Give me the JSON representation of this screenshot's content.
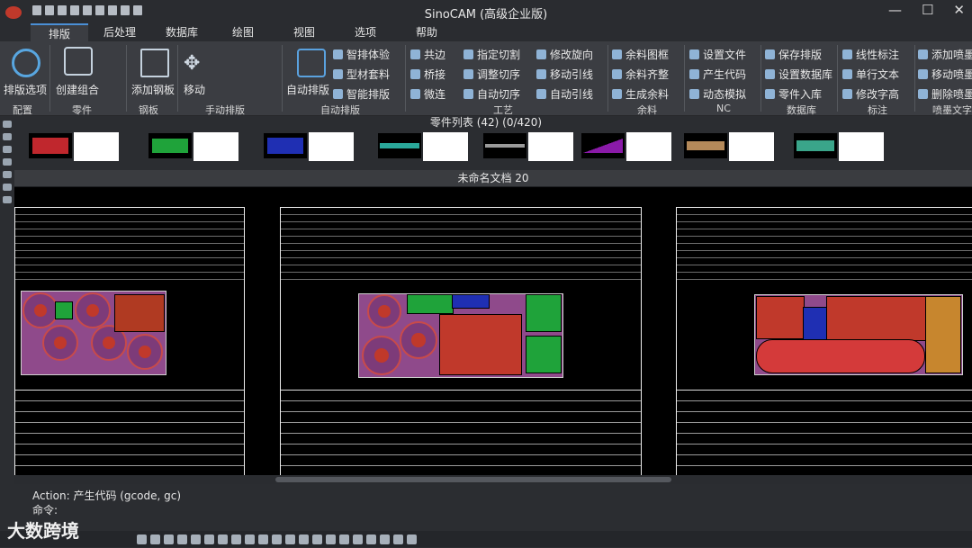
{
  "window": {
    "title": "SinoCAM (高级企业版)"
  },
  "menu": {
    "tabs": [
      "排版",
      "后处理",
      "数据库",
      "绘图",
      "视图",
      "选项",
      "帮助"
    ],
    "active": "排版"
  },
  "ribbon": {
    "layout_options": "排版选项",
    "create_combo": "创建组合",
    "add_plate": "添加钢板",
    "move": "移动",
    "auto_nest": "自动排版",
    "col_a": [
      "智排体验",
      "型材套料",
      "智能排版"
    ],
    "col_b": [
      "共边",
      "桥接",
      "微连"
    ],
    "col_c": [
      "指定切割",
      "调整切序",
      "自动切序"
    ],
    "col_d": [
      "修改旋向",
      "移动引线",
      "自动引线"
    ],
    "col_e": [
      "余料图框",
      "余料齐整",
      "生成余料"
    ],
    "col_f": [
      "设置文件",
      "产生代码",
      "动态模拟"
    ],
    "col_g": [
      "保存排版",
      "设置数据库",
      "零件入库"
    ],
    "col_h": [
      "线性标注",
      "单行文本",
      "修改字高"
    ],
    "col_i": [
      "添加喷墨",
      "移动喷墨",
      "删除喷墨"
    ],
    "groups": [
      "配置",
      "零件",
      "钢板",
      "手动排版",
      "自动排版",
      "工艺",
      "余料",
      "NC",
      "数据库",
      "标注",
      "喷墨文字"
    ]
  },
  "parts_list": {
    "title": "零件列表 (42) (0/420)"
  },
  "thumb_colors": [
    "#c0272d",
    "#1fa33a",
    "#1f2fb3",
    "#2aa89a",
    "#9a9a9a",
    "#8a1aa8",
    "#b58a5a",
    "#3aa58a"
  ],
  "document": {
    "title": "未命名文档 20"
  },
  "command": {
    "action": "Action: 产生代码 (gcode, gc)",
    "prompt": "命令:"
  },
  "watermark": "大数跨境"
}
